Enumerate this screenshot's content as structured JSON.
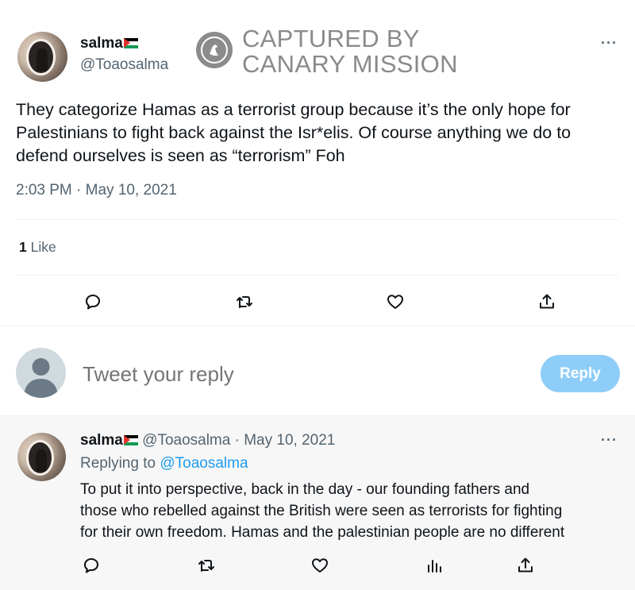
{
  "main_tweet": {
    "display_name": "salma",
    "handle": "@Toaosalma",
    "text": "They categorize Hamas as a terrorist group because it’s the only hope for Palestinians to fight back against the Isr*elis. Of course anything we do to defend ourselves is seen as “terrorism” Foh",
    "timestamp": "2:03 PM · May 10, 2021",
    "likes_count": "1",
    "likes_label": "Like",
    "more_label": "···"
  },
  "watermark": {
    "line1": "CAPTURED BY",
    "line2": "CANARY MISSION"
  },
  "reply_composer": {
    "placeholder": "Tweet your reply",
    "button_label": "Reply"
  },
  "reply_tweet": {
    "display_name": "salma",
    "handle": "@Toaosalma",
    "separator": "·",
    "date": "May 10, 2021",
    "replying_prefix": "Replying to",
    "replying_to": "@Toaosalma",
    "line1": "To put it into perspective, back in the day - our founding fathers and",
    "line2": "those who rebelled against the British were seen as terrorists for fighting",
    "line3": "for their own freedom. Hamas and the palestinian people are no different",
    "more_label": "···"
  },
  "icons": {
    "reply": "speech-bubble-icon",
    "retweet": "retweet-icon",
    "like": "heart-icon",
    "share": "share-icon",
    "views": "bar-chart-icon",
    "flag": "palestine-flag-icon",
    "watermark_logo": "bird-in-circle-icon"
  },
  "colors": {
    "accent": "#1d9bf0",
    "reply_button": "#8ecdf8",
    "muted_text": "#536471",
    "watermark": "#8a8a8a"
  }
}
